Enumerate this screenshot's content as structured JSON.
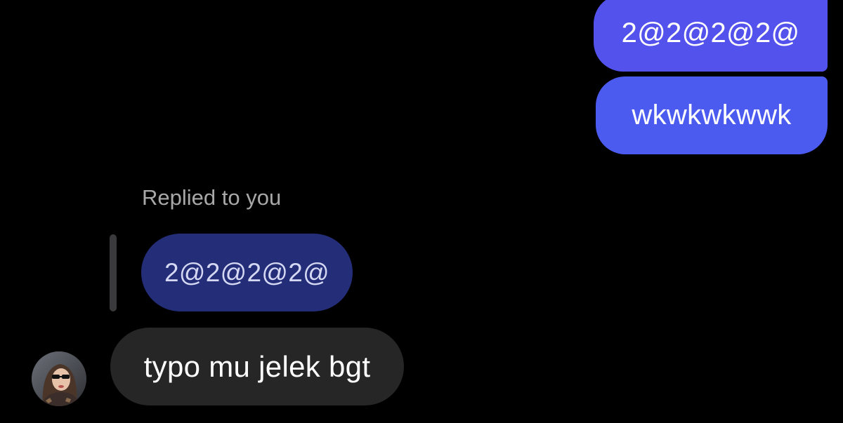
{
  "messages": {
    "sent": [
      {
        "text": "2@2@2@2@"
      },
      {
        "text": "wkwkwkwwk"
      }
    ],
    "reply": {
      "label": "Replied to you",
      "quoted_text": "2@2@2@2@"
    },
    "received": [
      {
        "text": "typo mu jelek bgt"
      }
    ]
  },
  "colors": {
    "background": "#000000",
    "sent_bubble": "#5452ec",
    "quoted_bubble": "#232d78",
    "received_bubble": "#262626"
  },
  "icons": {
    "avatar": "user-avatar"
  }
}
